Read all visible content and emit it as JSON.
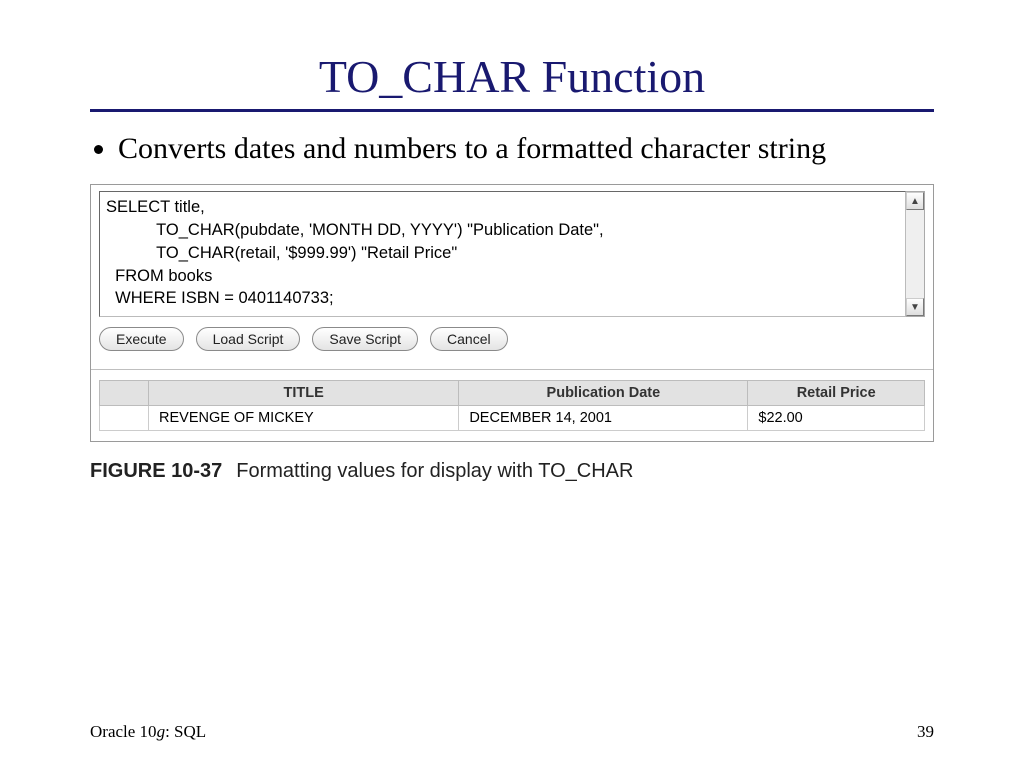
{
  "title": "TO_CHAR Function",
  "bullet": "Converts dates and numbers to a formatted character string",
  "sql": {
    "line1": "SELECT title,",
    "line2": "           TO_CHAR(pubdate, 'MONTH DD, YYYY') \"Publication Date\",",
    "line3": "           TO_CHAR(retail, '$999.99') \"Retail Price\"",
    "line4": "  FROM books",
    "line5": "  WHERE ISBN = 0401140733;"
  },
  "buttons": {
    "execute": "Execute",
    "load": "Load Script",
    "save": "Save Script",
    "cancel": "Cancel"
  },
  "table": {
    "headers": {
      "title": "TITLE",
      "pubdate": "Publication Date",
      "retail": "Retail Price"
    },
    "row": {
      "title": "REVENGE OF MICKEY",
      "pubdate": "DECEMBER  14, 2001",
      "retail": "$22.00"
    }
  },
  "figure": {
    "number": "FIGURE 10-37",
    "caption": "Formatting values for display with TO_CHAR"
  },
  "footer": {
    "left_prefix": "Oracle 10",
    "left_g": "g",
    "left_suffix": ": SQL",
    "page": "39"
  }
}
